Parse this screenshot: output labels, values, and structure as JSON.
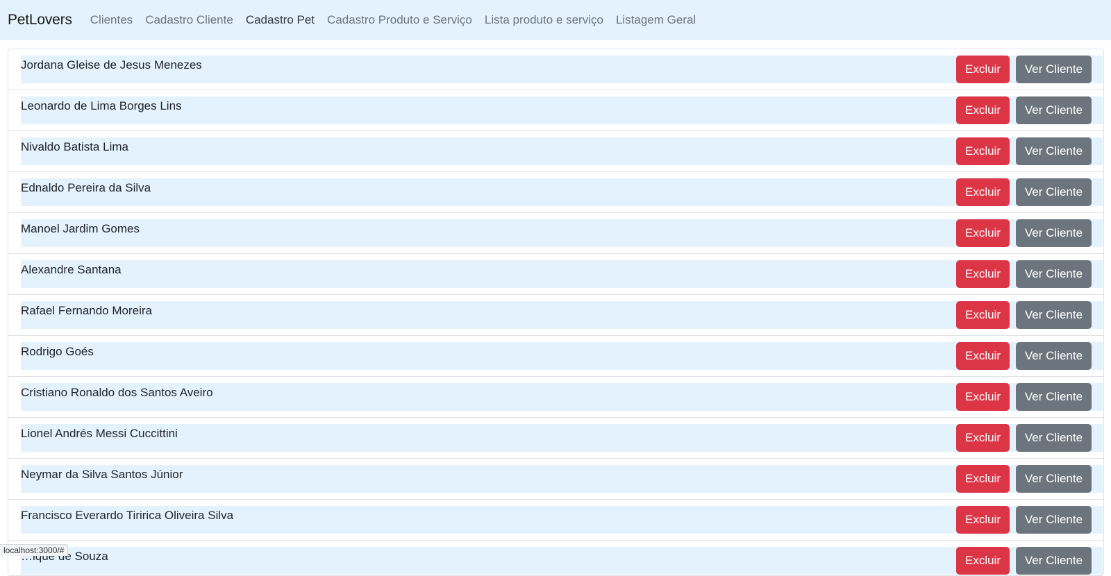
{
  "navbar": {
    "brand": "PetLovers",
    "links": [
      {
        "label": "Clientes"
      },
      {
        "label": "Cadastro Cliente"
      },
      {
        "label": "Cadastro Pet"
      },
      {
        "label": "Cadastro Produto e Serviço"
      },
      {
        "label": "Lista produto e serviço"
      },
      {
        "label": "Listagem Geral"
      }
    ],
    "active_index": 2
  },
  "clients": {
    "delete_label": "Excluir",
    "view_label": "Ver Cliente",
    "items": [
      {
        "name": "Jordana Gleise de Jesus Menezes"
      },
      {
        "name": "Leonardo de Lima Borges Lins"
      },
      {
        "name": "Nivaldo Batista Lima"
      },
      {
        "name": "Ednaldo Pereira da Silva"
      },
      {
        "name": "Manoel Jardim Gomes"
      },
      {
        "name": "Alexandre Santana"
      },
      {
        "name": "Rafael Fernando Moreira"
      },
      {
        "name": "Rodrigo Goés"
      },
      {
        "name": "Cristiano Ronaldo dos Santos Aveiro"
      },
      {
        "name": "Lionel Andrés Messi Cuccittini"
      },
      {
        "name": "Neymar da Silva Santos Júnior"
      },
      {
        "name": "Francisco Everardo Tiririca Oliveira Silva"
      },
      {
        "name": "…ique de Souza"
      }
    ]
  },
  "status_bar": {
    "url": "localhost:3000/#"
  },
  "colors": {
    "navbar_bg": "#e3f2fd",
    "row_band": "#e3f2fd",
    "danger": "#dc3545",
    "secondary": "#6c757d"
  }
}
